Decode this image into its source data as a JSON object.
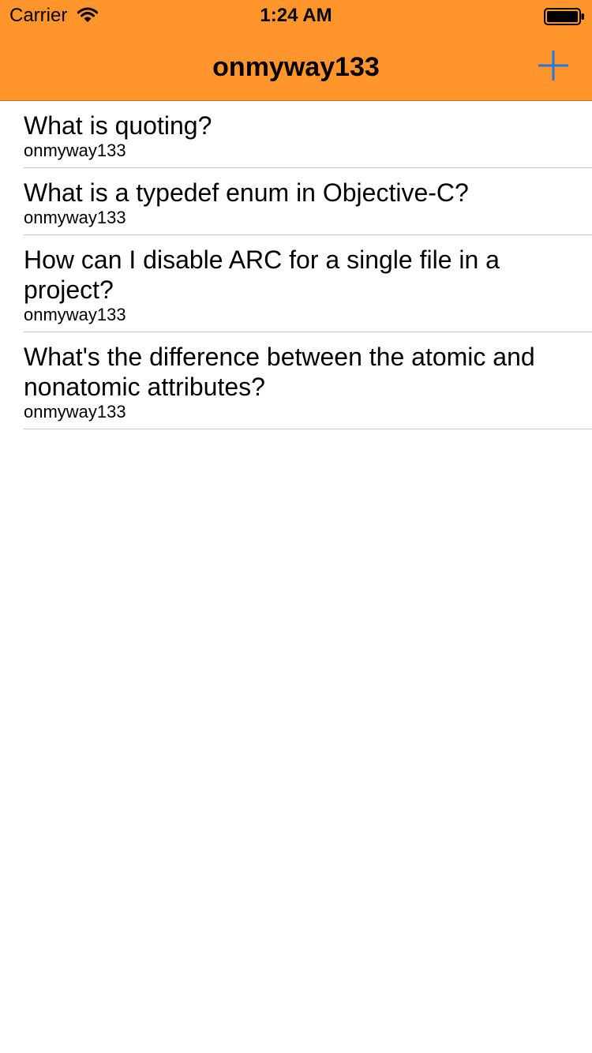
{
  "status_bar": {
    "carrier": "Carrier",
    "time": "1:24 AM",
    "wifi_icon": "wifi-icon",
    "battery_icon": "battery-icon"
  },
  "nav_bar": {
    "title": "onmyway133",
    "add_icon": "plus-icon",
    "background_color": "#FF952B",
    "accent_color": "#1F7AE0"
  },
  "questions": [
    {
      "title": "What is quoting?",
      "author": "onmyway133"
    },
    {
      "title": "What is a typedef enum in Objective-C?",
      "author": "onmyway133"
    },
    {
      "title": "How can I disable ARC for a single file in a project?",
      "author": "onmyway133"
    },
    {
      "title": "What's the difference between the atomic and nonatomic attributes?",
      "author": "onmyway133"
    }
  ]
}
